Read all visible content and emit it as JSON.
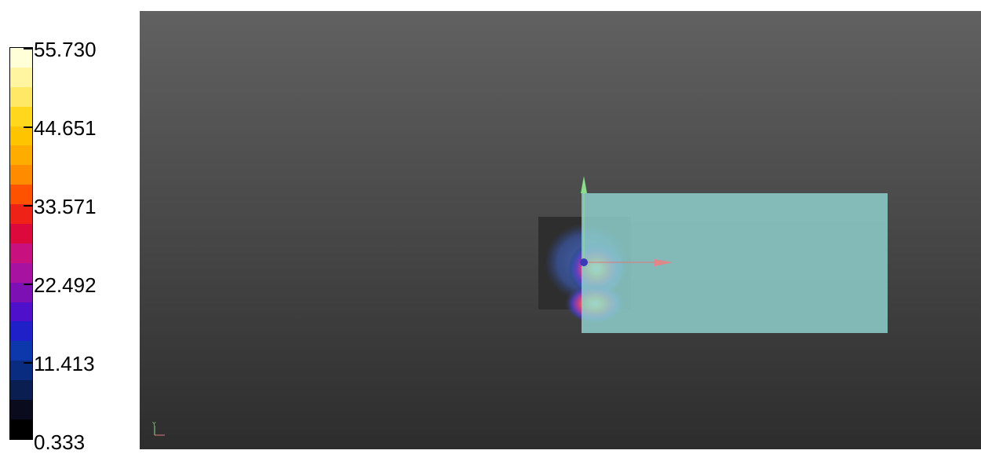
{
  "scalar_bar": {
    "colors": [
      "#ffffd8",
      "#fff5a0",
      "#ffe866",
      "#ffd81e",
      "#ffc400",
      "#ffac00",
      "#ff8c00",
      "#ff5200",
      "#ee2216",
      "#dc0a3c",
      "#c8107e",
      "#a712a0",
      "#7c10b4",
      "#4f10cc",
      "#2020c8",
      "#0c38ac",
      "#0a2c80",
      "#0a1e52",
      "#0a0c1e",
      "#000000"
    ],
    "labels": [
      "55.730",
      "44.651",
      "33.571",
      "22.492",
      "11.413",
      "0.333"
    ]
  },
  "scene": {
    "plane_color": "#8ecfcc",
    "probe_color": "#2e2e2e",
    "x_axis_color": "#e07878",
    "y_axis_color": "#8ae08a",
    "origin_color": "#3a3ab8"
  }
}
